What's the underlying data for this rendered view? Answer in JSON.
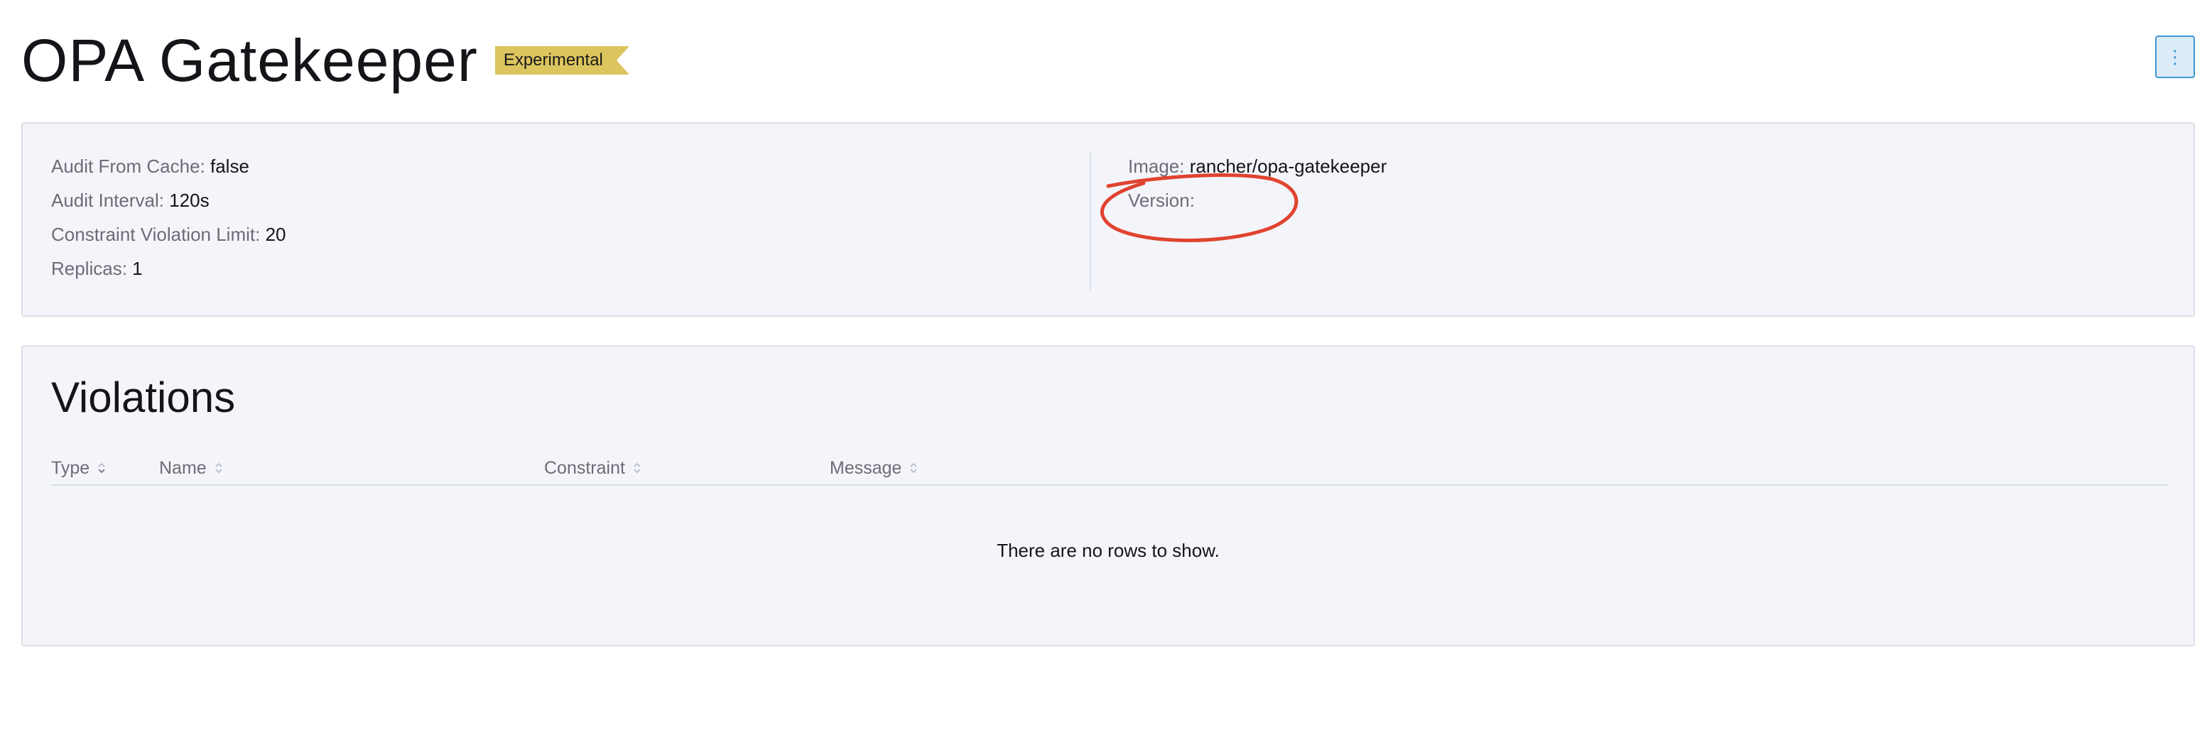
{
  "header": {
    "title": "OPA Gatekeeper",
    "badge": "Experimental",
    "menu_icon": "more-vertical-icon",
    "menu_glyph": "⋮"
  },
  "info": {
    "left": [
      {
        "label": "Audit From Cache:",
        "value": "false"
      },
      {
        "label": "Audit Interval:",
        "value": "120s"
      },
      {
        "label": "Constraint Violation Limit:",
        "value": "20"
      },
      {
        "label": "Replicas:",
        "value": "1"
      }
    ],
    "right": [
      {
        "label": "Image:",
        "value": "rancher/opa-gatekeeper"
      },
      {
        "label": "Version:",
        "value": ""
      }
    ]
  },
  "violations": {
    "title": "Violations",
    "columns": [
      "Type",
      "Name",
      "Constraint",
      "Message"
    ],
    "empty_message": "There are no rows to show."
  },
  "colors": {
    "accent": "#3d98d3",
    "badge": "#dcc55e",
    "annotation": "#e0432f",
    "panel_bg": "#f4f5fa"
  }
}
